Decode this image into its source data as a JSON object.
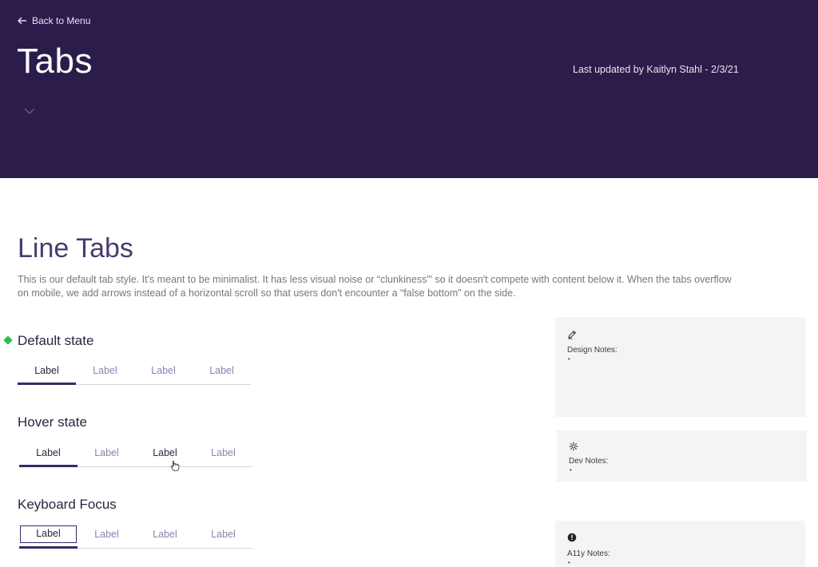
{
  "header": {
    "back_label": "Back to Menu",
    "title": "Tabs",
    "last_updated": "Last updated by Kaitlyn Stahl - 2/3/21"
  },
  "section": {
    "title": "Line Tabs",
    "description": "This is our default tab style. It's meant to be minimalist. It has less visual noise or “clunkiness”' so it doesn't compete with content below it. When the tabs overflow on mobile, we add arrows instead of a horizontal scroll so that users don't encounter a “false bottom” on the side."
  },
  "states": [
    {
      "title": "Default state",
      "tabs": [
        "Label",
        "Label",
        "Label",
        "Label"
      ]
    },
    {
      "title": "Hover state",
      "tabs": [
        "Label",
        "Label",
        "Label",
        "Label"
      ]
    },
    {
      "title": "Keyboard Focus",
      "tabs": [
        "Label",
        "Label",
        "Label",
        "Label"
      ]
    }
  ],
  "notes": {
    "design": {
      "label": "Design Notes:",
      "bullet": "•",
      "icon": "pencil-icon"
    },
    "dev": {
      "label": "Dev Notes:",
      "bullet": "•",
      "icon": "gear-icon"
    },
    "a11y": {
      "label": "A11y Notes:",
      "bullet": "•",
      "icon": "info-icon"
    }
  },
  "colors": {
    "header_bg": "#2c1c4b",
    "accent": "#3c2866",
    "status_marker": "#2bbd4b"
  }
}
